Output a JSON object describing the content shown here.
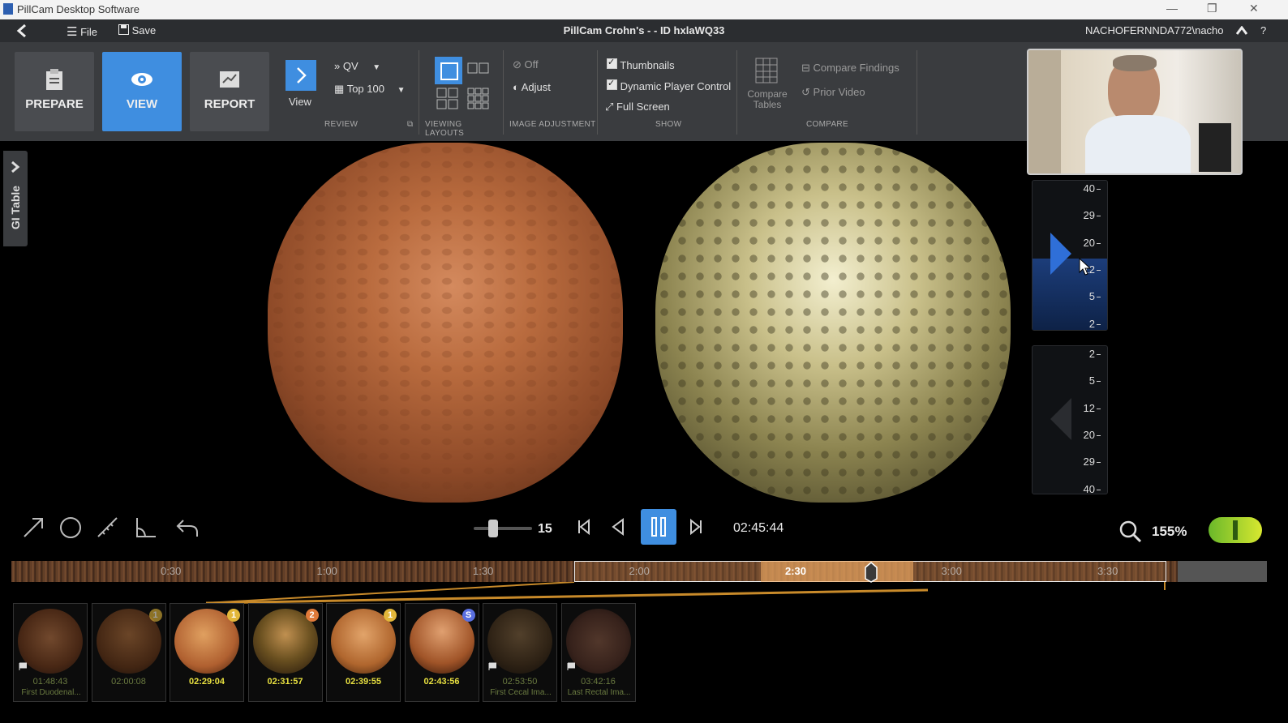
{
  "window": {
    "app_title": "PillCam Desktop Software",
    "minimize": "—",
    "restore": "❐",
    "close": "✕"
  },
  "menubar": {
    "file": "File",
    "save": "Save",
    "study_title": "PillCam Crohn's - - ID hxlaWQ33",
    "user": "NACHOFERNNDA772\\nacho",
    "help": "?"
  },
  "ribbon": {
    "modes": {
      "prepare": "PREPARE",
      "view": "VIEW",
      "report": "REPORT",
      "active": "view"
    },
    "review": {
      "view_label": "View",
      "qv_label": "QV",
      "top100_label": "Top 100",
      "group_label": "REVIEW"
    },
    "viewing_layouts": {
      "group_label": "VIEWING LAYOUTS"
    },
    "image_adjustment": {
      "off_label": "Off",
      "adjust_label": "Adjust",
      "group_label": "IMAGE ADJUSTMENT"
    },
    "show": {
      "thumbnails": "Thumbnails",
      "dynamic_player_control": "Dynamic Player Control",
      "full_screen": "Full Screen",
      "group_label": "SHOW"
    },
    "compare": {
      "compare_tables": "Compare Tables",
      "compare_findings": "Compare Findings",
      "prior_video": "Prior Video",
      "group_label": "COMPARE"
    }
  },
  "side_tab": {
    "label": "GI Table"
  },
  "speed_forward": {
    "ticks": [
      "40",
      "29",
      "20",
      "12",
      "5",
      "2"
    ]
  },
  "speed_reverse": {
    "ticks": [
      "2",
      "5",
      "12",
      "20",
      "29",
      "40"
    ]
  },
  "player": {
    "speed_value": "15",
    "time": "02:45:44",
    "zoom": "155%"
  },
  "timeline": {
    "labels": [
      "0:30",
      "1:00",
      "1:30",
      "2:00",
      "2:30",
      "3:00",
      "3:30"
    ]
  },
  "thumbnails": [
    {
      "time": "01:48:43",
      "caption": "First Duodenal...",
      "badge": "",
      "flag": true,
      "dim": true
    },
    {
      "time": "02:00:08",
      "caption": "",
      "badge": "1",
      "flag": false,
      "dim": true
    },
    {
      "time": "02:29:04",
      "caption": "",
      "badge": "1",
      "flag": false,
      "dim": false
    },
    {
      "time": "02:31:57",
      "caption": "",
      "badge": "2",
      "flag": false,
      "dim": false
    },
    {
      "time": "02:39:55",
      "caption": "",
      "badge": "1",
      "flag": false,
      "dim": false
    },
    {
      "time": "02:43:56",
      "caption": "",
      "badge": "S",
      "flag": false,
      "dim": false
    },
    {
      "time": "02:53:50",
      "caption": "First Cecal Ima...",
      "badge": "",
      "flag": true,
      "dim": true
    },
    {
      "time": "03:42:16",
      "caption": "Last Rectal Ima...",
      "badge": "",
      "flag": true,
      "dim": true
    }
  ],
  "colors": {
    "accent": "#3f8ee0",
    "ribbon": "#3a3c3f",
    "badge_yellow": "#e2b73a",
    "badge_orange": "#e07a3a",
    "badge_blue": "#5a6fe0",
    "timestamp": "#e8e040"
  },
  "icons": {
    "back": "chevron-left-icon",
    "file": "hamburger-menu-icon",
    "save": "floppy-disk-icon",
    "up": "chevron-up-icon",
    "prepare": "clipboard-icon",
    "view": "eye-icon",
    "report": "report-icon",
    "tools": [
      "arrow-tool-icon",
      "circle-tool-icon",
      "ruler-tool-icon",
      "angle-tool-icon",
      "undo-icon"
    ],
    "zoom": "magnifier-icon"
  }
}
